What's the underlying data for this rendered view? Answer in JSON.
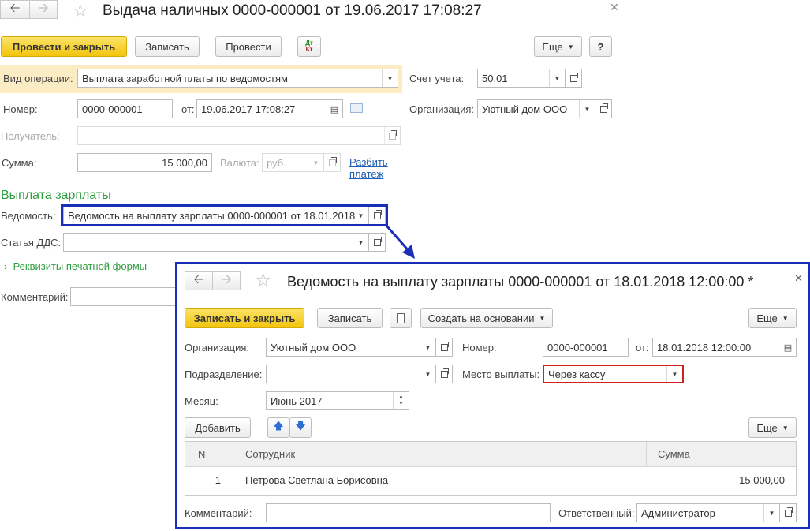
{
  "main": {
    "title": "Выдача наличных 0000-000001 от 19.06.2017 17:08:27",
    "toolbar": {
      "post_close": "Провести и закрыть",
      "save": "Записать",
      "post": "Провести",
      "more": "Еще",
      "help": "?",
      "dtkt_top": "Дт",
      "dtkt_bottom": "Кт"
    },
    "op_type": {
      "label": "Вид операции:",
      "value": "Выплата заработной платы по ведомостям"
    },
    "account": {
      "label": "Счет учета:",
      "value": "50.01"
    },
    "number": {
      "label": "Номер:",
      "value": "0000-000001"
    },
    "date": {
      "label": "от:",
      "value": "19.06.2017 17:08:27"
    },
    "org": {
      "label": "Организация:",
      "value": "Уютный дом ООО"
    },
    "recipient": {
      "label": "Получатель:",
      "value": ""
    },
    "sum": {
      "label": "Сумма:",
      "value": "15 000,00"
    },
    "currency": {
      "label": "Валюта:",
      "value": "руб."
    },
    "split_link": {
      "line1": "Разбить",
      "line2": "платеж"
    },
    "section_title": "Выплата зарплаты",
    "statement": {
      "label": "Ведомость:",
      "value": "Ведомость на выплату зарплаты 0000-000001 от 18.01.2018"
    },
    "dds": {
      "label": "Статья ДДС:",
      "value": ""
    },
    "print_details": "Реквизиты печатной формы",
    "comment": {
      "label": "Комментарий:",
      "value": ""
    }
  },
  "popup": {
    "title": "Ведомость на выплату зарплаты 0000-000001 от 18.01.2018 12:00:00 *",
    "toolbar": {
      "save_close": "Записать и закрыть",
      "save": "Записать",
      "create_based": "Создать на основании",
      "more": "Еще"
    },
    "org": {
      "label": "Организация:",
      "value": "Уютный дом ООО"
    },
    "number": {
      "label": "Номер:",
      "value": "0000-000001"
    },
    "date": {
      "label": "от:",
      "value": "18.01.2018 12:00:00"
    },
    "division": {
      "label": "Подразделение:",
      "value": ""
    },
    "pay_place": {
      "label": "Место выплаты:",
      "value": "Через кассу"
    },
    "month": {
      "label": "Месяц:",
      "value": "Июнь 2017"
    },
    "add": "Добавить",
    "table_more": "Еще",
    "table": {
      "headers": [
        "N",
        "Сотрудник",
        "Сумма"
      ],
      "rows": [
        {
          "n": "1",
          "employee": "Петрова Светлана Борисовна",
          "sum": "15 000,00"
        }
      ]
    },
    "comment": {
      "label": "Комментарий:",
      "value": ""
    },
    "responsible": {
      "label": "Ответственный:",
      "value": "Администратор"
    }
  },
  "colors": {
    "highlight_blue": "#1a2fb8",
    "highlight_red": "#d21f1f",
    "yellow_button": "#f2c40c",
    "green_text": "#2e9e3e",
    "link": "#1f5fb5"
  }
}
